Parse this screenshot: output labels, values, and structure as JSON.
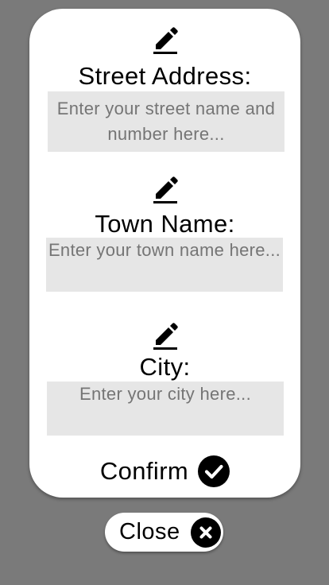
{
  "form": {
    "street": {
      "icon": "edit-pencil-icon",
      "label": "Street Address:",
      "placeholder": "Enter your street name and number here..."
    },
    "town": {
      "icon": "edit-pencil-icon",
      "label": "Town Name:",
      "placeholder": "Enter your town name here..."
    },
    "city": {
      "icon": "edit-pencil-icon",
      "label": "City:",
      "placeholder": "Enter your city here..."
    }
  },
  "confirm": {
    "label": "Confirm",
    "icon": "check-circle-icon"
  },
  "close": {
    "label": "Close",
    "icon": "close-circle-icon"
  },
  "colors": {
    "overlay": "#7a7a7a",
    "card": "#ffffff",
    "input_bg": "#e6e6e6",
    "placeholder": "#9a9a9a",
    "text": "#000000"
  }
}
